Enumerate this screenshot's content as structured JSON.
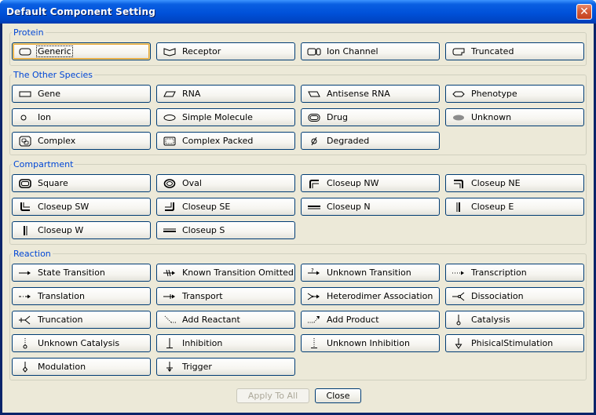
{
  "window": {
    "title": "Default Component Setting",
    "close_glyph": "✕"
  },
  "groups": {
    "protein": "Protein",
    "other": "The Other Species",
    "compartment": "Compartment",
    "reaction": "Reaction"
  },
  "protein": {
    "generic": "Generic",
    "receptor": "Receptor",
    "ion_channel": "Ion Channel",
    "truncated": "Truncated"
  },
  "other": {
    "gene": "Gene",
    "rna": "RNA",
    "antisense_rna": "Antisense RNA",
    "phenotype": "Phenotype",
    "ion": "Ion",
    "simple_molecule": "Simple Molecule",
    "drug": "Drug",
    "unknown": "Unknown",
    "complex": "Complex",
    "complex_packed": "Complex Packed",
    "degraded": "Degraded"
  },
  "compartment": {
    "square": "Square",
    "oval": "Oval",
    "closeup_nw": "Closeup NW",
    "closeup_ne": "Closeup NE",
    "closeup_sw": "Closeup SW",
    "closeup_se": "Closeup SE",
    "closeup_n": "Closeup N",
    "closeup_e": "Closeup E",
    "closeup_w": "Closeup W",
    "closeup_s": "Closeup S"
  },
  "reaction": {
    "state_transition": "State Transition",
    "known_transition_omitted": "Known Transition Omitted",
    "unknown_transition": "Unknown Transition",
    "transcription": "Transcription",
    "translation": "Translation",
    "transport": "Transport",
    "heterodimer_association": "Heterodimer Association",
    "dissociation": "Dissociation",
    "truncation": "Truncation",
    "add_reactant": "Add Reactant",
    "add_product": "Add Product",
    "catalysis": "Catalysis",
    "unknown_catalysis": "Unknown Catalysis",
    "inhibition": "Inhibition",
    "unknown_inhibition": "Unknown Inhibition",
    "physical_stimulation": "PhisicalStimulation",
    "modulation": "Modulation",
    "trigger": "Trigger"
  },
  "footer": {
    "apply_all": "Apply To All",
    "close": "Close"
  },
  "colors": {
    "title_bar": "#0054e3",
    "dialog_bg": "#ece9d8",
    "group_label": "#0046d5",
    "close_button": "#d45b38"
  }
}
